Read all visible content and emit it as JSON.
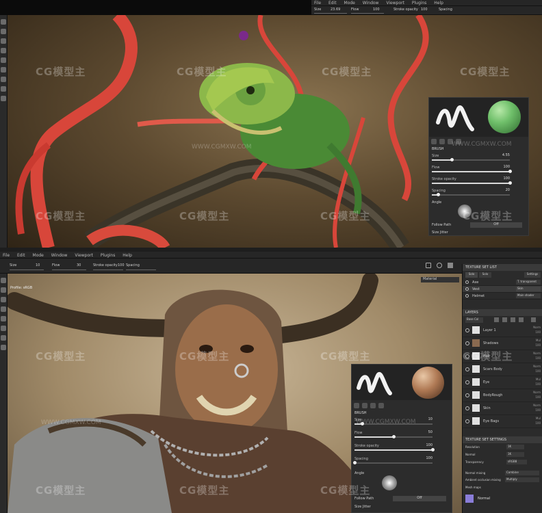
{
  "top_window": {
    "menu": [
      "File",
      "Edit",
      "Mode",
      "Window",
      "Viewport",
      "Plugins",
      "Help"
    ],
    "toolbar": {
      "size_label": "Size",
      "size_value": "23.69",
      "flow_label": "Flow",
      "flow_value": "100",
      "stroke_opacity_label": "Stroke opacity",
      "stroke_opacity_value": "100",
      "spacing_label": "Spacing"
    },
    "brush_panel": {
      "section_title": "BRUSH",
      "size_label": "Size",
      "size_value": "4.55",
      "size_fill": 0.25,
      "flow_label": "Flow",
      "flow_value": "100",
      "flow_fill": 1.0,
      "stroke_opacity_label": "Stroke opacity",
      "stroke_opacity_value": "100",
      "stroke_opacity_fill": 1.0,
      "spacing_label": "Spacing",
      "spacing_value": "20",
      "spacing_fill": 0.08,
      "angle_label": "Angle",
      "follow_path_label": "Follow Path",
      "follow_path_value": "Off",
      "size_jitter_label": "Size Jitter"
    }
  },
  "bottom_window": {
    "menu": [
      "File",
      "Edit",
      "Mode",
      "Window",
      "Viewport",
      "Plugins",
      "Help"
    ],
    "toolbar": {
      "size_label": "Size",
      "size_value": "10",
      "flow_label": "Flow",
      "flow_value": "30",
      "stroke_opacity_label": "Stroke opacity",
      "stroke_opacity_value": "100",
      "spacing_label": "Spacing"
    },
    "viewport_label": "Profile: sRGB",
    "material_dropdown": "Material",
    "brush_panel": {
      "section_title": "BRUSH",
      "size_label": "Size",
      "size_value": "10",
      "size_fill": 0.1,
      "flow_label": "Flow",
      "flow_value": "50",
      "flow_fill": 0.5,
      "stroke_opacity_label": "Stroke opacity",
      "stroke_opacity_value": "100",
      "stroke_opacity_fill": 1.0,
      "spacing_label": "Spacing",
      "spacing_value": "100",
      "spacing_fill": 0.0,
      "angle_label": "Angle",
      "follow_path_label": "Follow Path",
      "follow_path_value": "Off",
      "size_jitter_label": "Size Jitter"
    },
    "texture_set_list": {
      "title": "TEXTURE SET LIST",
      "tab1": "Solo",
      "tab2": "Solo",
      "settings": "Settings",
      "rows": [
        {
          "name": "Axe",
          "shader": "T. transparent"
        },
        {
          "name": "Vest",
          "shader": "Skin"
        },
        {
          "name": "Helmet",
          "shader": "Main shader"
        }
      ]
    },
    "layers": {
      "title": "LAYERS",
      "channel": "Base Col",
      "items": [
        {
          "name": "Layer 1",
          "blend": "Norm",
          "opacity": "100"
        },
        {
          "name": "Shadows",
          "blend": "Mul",
          "opacity": "100"
        },
        {
          "name": "Hair",
          "blend": "Norm",
          "opacity": "100"
        },
        {
          "name": "Scars Body",
          "blend": "Norm",
          "opacity": "100"
        },
        {
          "name": "Eye",
          "blend": "Mul",
          "opacity": "100"
        },
        {
          "name": "BodyRough",
          "blend": "Norm",
          "opacity": "100"
        },
        {
          "name": "Skin",
          "blend": "Norm",
          "opacity": "100"
        },
        {
          "name": "Eye Bags",
          "blend": "Mul",
          "opacity": "100"
        }
      ]
    },
    "texture_set_settings": {
      "title": "TEXTURE SET SETTINGS",
      "rows": [
        {
          "label": "Resolution",
          "value": "1K"
        },
        {
          "label": "Normal",
          "value": "1K"
        },
        {
          "label": "Transparency",
          "value": "sRGB8"
        }
      ],
      "normal_mixing_label": "Normal mixing",
      "normal_mixing_value": "Combine",
      "ambient_label": "Ambient occlusion mixing",
      "ambient_value": "Multiply",
      "mesh_maps_label": "Mesh maps",
      "normal_map_label": "Normal"
    }
  },
  "watermark": {
    "logo": "CG模型主",
    "url": "WWW.CGMXW.COM"
  },
  "colors": {
    "panel_bg": "#2c2c2c",
    "accent": "#8a7dd8"
  }
}
